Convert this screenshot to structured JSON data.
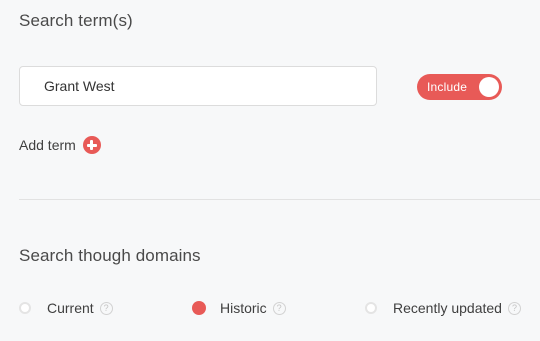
{
  "search_terms": {
    "title": "Search term(s)",
    "input_value": "Grant West",
    "toggle_label": "Include",
    "toggle_on": true,
    "add_term_label": "Add term"
  },
  "domains": {
    "title": "Search though domains",
    "options": [
      {
        "label": "Current",
        "selected": false,
        "help": "?"
      },
      {
        "label": "Historic",
        "selected": true,
        "help": "?"
      },
      {
        "label": "Recently updated",
        "selected": false,
        "help": "?"
      }
    ]
  },
  "colors": {
    "accent": "#e85a57",
    "background": "#f7f8f9"
  }
}
